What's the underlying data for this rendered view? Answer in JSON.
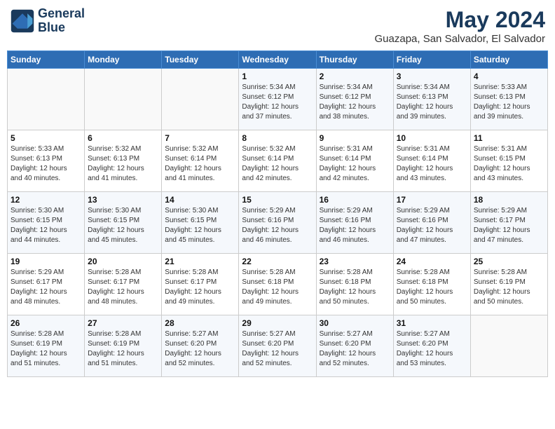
{
  "logo": {
    "line1": "General",
    "line2": "Blue"
  },
  "header": {
    "month": "May 2024",
    "location": "Guazapa, San Salvador, El Salvador"
  },
  "weekdays": [
    "Sunday",
    "Monday",
    "Tuesday",
    "Wednesday",
    "Thursday",
    "Friday",
    "Saturday"
  ],
  "weeks": [
    [
      {
        "day": "",
        "info": ""
      },
      {
        "day": "",
        "info": ""
      },
      {
        "day": "",
        "info": ""
      },
      {
        "day": "1",
        "info": "Sunrise: 5:34 AM\nSunset: 6:12 PM\nDaylight: 12 hours\nand 37 minutes."
      },
      {
        "day": "2",
        "info": "Sunrise: 5:34 AM\nSunset: 6:12 PM\nDaylight: 12 hours\nand 38 minutes."
      },
      {
        "day": "3",
        "info": "Sunrise: 5:34 AM\nSunset: 6:13 PM\nDaylight: 12 hours\nand 39 minutes."
      },
      {
        "day": "4",
        "info": "Sunrise: 5:33 AM\nSunset: 6:13 PM\nDaylight: 12 hours\nand 39 minutes."
      }
    ],
    [
      {
        "day": "5",
        "info": "Sunrise: 5:33 AM\nSunset: 6:13 PM\nDaylight: 12 hours\nand 40 minutes."
      },
      {
        "day": "6",
        "info": "Sunrise: 5:32 AM\nSunset: 6:13 PM\nDaylight: 12 hours\nand 41 minutes."
      },
      {
        "day": "7",
        "info": "Sunrise: 5:32 AM\nSunset: 6:14 PM\nDaylight: 12 hours\nand 41 minutes."
      },
      {
        "day": "8",
        "info": "Sunrise: 5:32 AM\nSunset: 6:14 PM\nDaylight: 12 hours\nand 42 minutes."
      },
      {
        "day": "9",
        "info": "Sunrise: 5:31 AM\nSunset: 6:14 PM\nDaylight: 12 hours\nand 42 minutes."
      },
      {
        "day": "10",
        "info": "Sunrise: 5:31 AM\nSunset: 6:14 PM\nDaylight: 12 hours\nand 43 minutes."
      },
      {
        "day": "11",
        "info": "Sunrise: 5:31 AM\nSunset: 6:15 PM\nDaylight: 12 hours\nand 43 minutes."
      }
    ],
    [
      {
        "day": "12",
        "info": "Sunrise: 5:30 AM\nSunset: 6:15 PM\nDaylight: 12 hours\nand 44 minutes."
      },
      {
        "day": "13",
        "info": "Sunrise: 5:30 AM\nSunset: 6:15 PM\nDaylight: 12 hours\nand 45 minutes."
      },
      {
        "day": "14",
        "info": "Sunrise: 5:30 AM\nSunset: 6:15 PM\nDaylight: 12 hours\nand 45 minutes."
      },
      {
        "day": "15",
        "info": "Sunrise: 5:29 AM\nSunset: 6:16 PM\nDaylight: 12 hours\nand 46 minutes."
      },
      {
        "day": "16",
        "info": "Sunrise: 5:29 AM\nSunset: 6:16 PM\nDaylight: 12 hours\nand 46 minutes."
      },
      {
        "day": "17",
        "info": "Sunrise: 5:29 AM\nSunset: 6:16 PM\nDaylight: 12 hours\nand 47 minutes."
      },
      {
        "day": "18",
        "info": "Sunrise: 5:29 AM\nSunset: 6:17 PM\nDaylight: 12 hours\nand 47 minutes."
      }
    ],
    [
      {
        "day": "19",
        "info": "Sunrise: 5:29 AM\nSunset: 6:17 PM\nDaylight: 12 hours\nand 48 minutes."
      },
      {
        "day": "20",
        "info": "Sunrise: 5:28 AM\nSunset: 6:17 PM\nDaylight: 12 hours\nand 48 minutes."
      },
      {
        "day": "21",
        "info": "Sunrise: 5:28 AM\nSunset: 6:17 PM\nDaylight: 12 hours\nand 49 minutes."
      },
      {
        "day": "22",
        "info": "Sunrise: 5:28 AM\nSunset: 6:18 PM\nDaylight: 12 hours\nand 49 minutes."
      },
      {
        "day": "23",
        "info": "Sunrise: 5:28 AM\nSunset: 6:18 PM\nDaylight: 12 hours\nand 50 minutes."
      },
      {
        "day": "24",
        "info": "Sunrise: 5:28 AM\nSunset: 6:18 PM\nDaylight: 12 hours\nand 50 minutes."
      },
      {
        "day": "25",
        "info": "Sunrise: 5:28 AM\nSunset: 6:19 PM\nDaylight: 12 hours\nand 50 minutes."
      }
    ],
    [
      {
        "day": "26",
        "info": "Sunrise: 5:28 AM\nSunset: 6:19 PM\nDaylight: 12 hours\nand 51 minutes."
      },
      {
        "day": "27",
        "info": "Sunrise: 5:28 AM\nSunset: 6:19 PM\nDaylight: 12 hours\nand 51 minutes."
      },
      {
        "day": "28",
        "info": "Sunrise: 5:27 AM\nSunset: 6:20 PM\nDaylight: 12 hours\nand 52 minutes."
      },
      {
        "day": "29",
        "info": "Sunrise: 5:27 AM\nSunset: 6:20 PM\nDaylight: 12 hours\nand 52 minutes."
      },
      {
        "day": "30",
        "info": "Sunrise: 5:27 AM\nSunset: 6:20 PM\nDaylight: 12 hours\nand 52 minutes."
      },
      {
        "day": "31",
        "info": "Sunrise: 5:27 AM\nSunset: 6:20 PM\nDaylight: 12 hours\nand 53 minutes."
      },
      {
        "day": "",
        "info": ""
      }
    ]
  ]
}
